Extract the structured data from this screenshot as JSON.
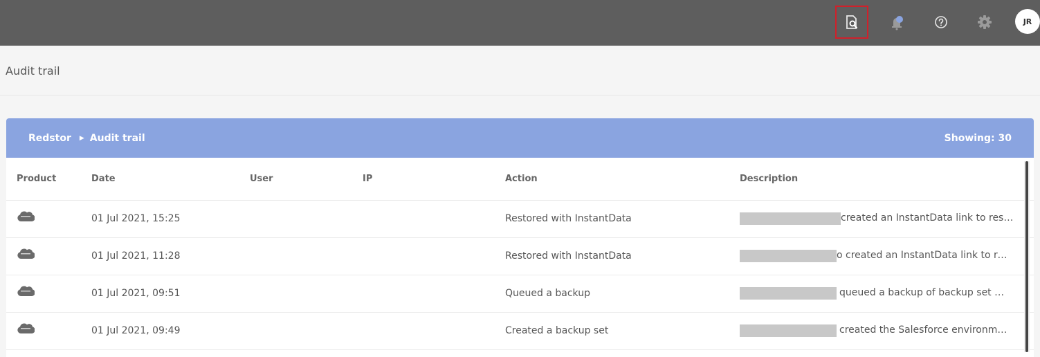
{
  "topbar": {
    "icons": [
      "search-document-icon",
      "notification-bell-icon",
      "help-icon",
      "gear-icon"
    ],
    "avatar_initials": "JR"
  },
  "page": {
    "title": "Audit trail"
  },
  "card": {
    "breadcrumb": [
      "Redstor",
      "Audit trail"
    ],
    "showing": "Showing: 30"
  },
  "table": {
    "headers": [
      "Product",
      "Date",
      "User",
      "IP",
      "Action",
      "Description"
    ],
    "rows": [
      {
        "product_icon": "salesforce-icon",
        "date": "01 Jul 2021, 15:25",
        "user": "",
        "ip": "",
        "action": "Restored with InstantData",
        "description": "created an InstantData link to res…"
      },
      {
        "product_icon": "salesforce-icon",
        "date": "01 Jul 2021, 11:28",
        "user": "",
        "ip": "",
        "action": "Restored with InstantData",
        "description": "o created an InstantData link to res…"
      },
      {
        "product_icon": "salesforce-icon",
        "date": "01 Jul 2021, 09:51",
        "user": "",
        "ip": "",
        "action": "Queued a backup",
        "description": "queued a backup of backup set …"
      },
      {
        "product_icon": "salesforce-icon",
        "date": "01 Jul 2021, 09:49",
        "user": "",
        "ip": "",
        "action": "Created a backup set",
        "description": "created the Salesforce environm…"
      }
    ]
  },
  "colors": {
    "topbar": "#5e5e5e",
    "card_header": "#8aa4e0",
    "highlight": "#d0202a"
  }
}
